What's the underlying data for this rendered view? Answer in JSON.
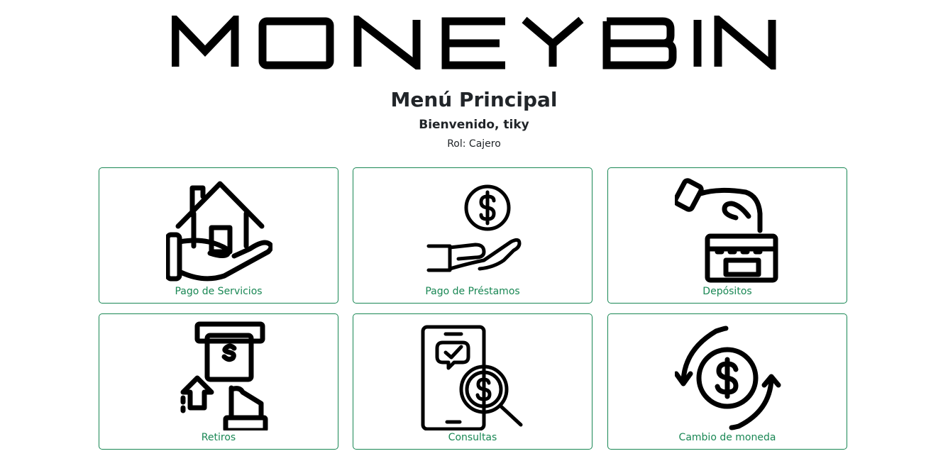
{
  "logo": {
    "text": "MONEY BIN"
  },
  "header": {
    "title": "Menú Principal",
    "welcome": "Bienvenido, tiky",
    "role": "Rol: Cajero"
  },
  "menu": {
    "items": [
      {
        "label": "Pago de Servicios",
        "icon": "house-in-hand-icon"
      },
      {
        "label": "Pago de Préstamos",
        "icon": "hand-coin-icon"
      },
      {
        "label": "Depósitos",
        "icon": "deposit-box-icon"
      },
      {
        "label": "Retiros",
        "icon": "atm-withdraw-icon"
      },
      {
        "label": "Consultas",
        "icon": "phone-search-icon"
      },
      {
        "label": "Cambio de moneda",
        "icon": "currency-exchange-icon"
      }
    ]
  },
  "colors": {
    "accent": "#198754",
    "text": "#212529"
  }
}
